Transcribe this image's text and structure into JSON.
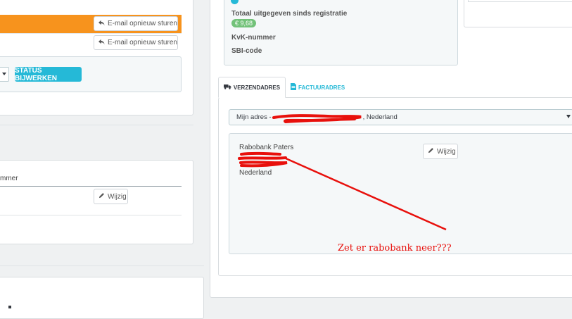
{
  "orders": {
    "resend_button_1": "E-mail opnieuw sturen",
    "resend_button_2": "E-mail opnieuw sturen",
    "update_status_button": "STATUS BIJWERKEN",
    "table_header_tail": "mmer",
    "edit_button": "Wijzig"
  },
  "customer": {
    "total_spent_label": "Totaal uitgegeven sinds registratie",
    "total_spent_value": "€ 9,68",
    "kvk_label": "KvK-nummer",
    "sbi_label": "SBI-code"
  },
  "address": {
    "tabs": [
      {
        "label": "VERZENDADRES",
        "icon": "truck-icon",
        "active": true
      },
      {
        "label": "FACTUURADRES",
        "icon": "invoice-icon",
        "active": false
      }
    ],
    "select_prefix": "Mijn adres -",
    "select_suffix": ", Nederland",
    "lines": [
      "Rabobank Paters",
      "Nederland"
    ],
    "edit_button": "Wijzig"
  },
  "annotation": {
    "text": "Zet er rabobank neer???",
    "color": "#e8100c"
  },
  "colors": {
    "orange": "#f7931d",
    "blue": "#25b9d7",
    "green": "#72c279"
  }
}
